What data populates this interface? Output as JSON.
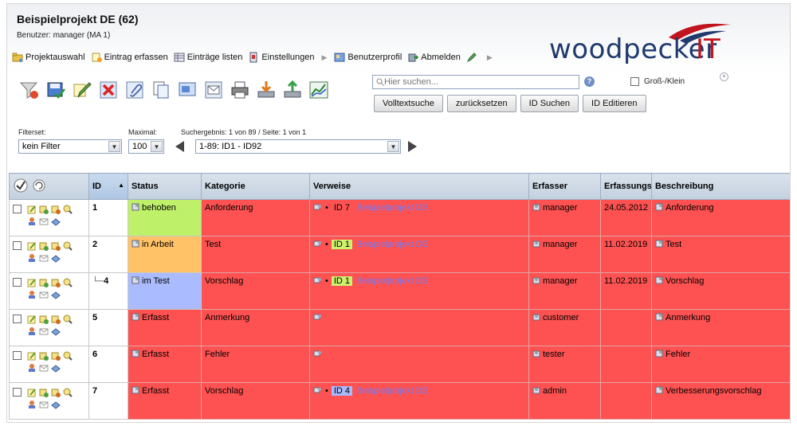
{
  "header": {
    "title": "Beispielprojekt DE (62)",
    "user": "Benutzer: manager (MA 1)"
  },
  "logo": {
    "main": "woodpecker",
    "suffix": "IT"
  },
  "menu": [
    {
      "label": "Projektauswahl",
      "icon": "folder-icon"
    },
    {
      "label": "Eintrag erfassen",
      "icon": "add-entry-icon"
    },
    {
      "label": "Einträge listen",
      "icon": "list-icon"
    },
    {
      "label": "Einstellungen",
      "icon": "settings-icon"
    },
    {
      "label": "Benutzerprofil",
      "icon": "profile-icon"
    },
    {
      "label": "Abmelden",
      "icon": "logout-icon"
    }
  ],
  "search": {
    "placeholder": "Hier suchen...",
    "case_label": "Groß-/Klein",
    "buttons": {
      "fulltext": "Volltextsuche",
      "reset": "zurücksetzen",
      "id_search": "ID Suchen",
      "id_edit": "ID Editieren"
    }
  },
  "filters": {
    "filterset_label": "Filterset:",
    "filterset_value": "kein Filter",
    "max_label": "Maximal:",
    "max_value": "100",
    "result_label": "Suchergebnis:  1 von 89 / Seite: 1 von 1",
    "result_value": "1-89: ID1 - ID92"
  },
  "table": {
    "headers": {
      "id": "ID",
      "status": "Status",
      "kategorie": "Kategorie",
      "verweise": "Verweise",
      "erfasser": "Erfasser",
      "datum": "Erfassungsdatum",
      "beschreibung": "Beschreibung"
    },
    "rows": [
      {
        "id": "1",
        "status": "behoben",
        "kategorie": "Anforderung",
        "ref_id": "ID 7",
        "ref_project": "Beispielprojekt DE",
        "erfasser": "manager",
        "datum": "24.05.2012",
        "beschreibung": "Anforderung"
      },
      {
        "id": "2",
        "status": "in Arbeit",
        "kategorie": "Test",
        "ref_id": "ID 1",
        "ref_project": "Beispielprojekt DE",
        "erfasser": "manager",
        "datum": "11.02.2019",
        "beschreibung": "Test"
      },
      {
        "id": "4",
        "status": "im Test",
        "kategorie": "Vorschlag",
        "ref_id": "ID 1",
        "ref_project": "Beispielprojekt DE",
        "erfasser": "manager",
        "datum": "11.02.2019",
        "beschreibung": "Vorschlag"
      },
      {
        "id": "5",
        "status": "Erfasst",
        "kategorie": "Anmerkung",
        "ref_id": "",
        "ref_project": "",
        "erfasser": "customer",
        "datum": "",
        "beschreibung": "Anmerkung"
      },
      {
        "id": "6",
        "status": "Erfasst",
        "kategorie": "Fehler",
        "ref_id": "",
        "ref_project": "",
        "erfasser": "tester",
        "datum": "",
        "beschreibung": "Fehler"
      },
      {
        "id": "7",
        "status": "Erfasst",
        "kategorie": "Vorschlag",
        "ref_id": "ID 4",
        "ref_project": "Beispielprojekt DE",
        "erfasser": "admin",
        "datum": "",
        "beschreibung": "Verbesserungsvorschlag"
      }
    ]
  },
  "colors": {
    "row_red": "#fe5151",
    "status_green": "#bff06a",
    "status_orange": "#ffc266",
    "status_blue": "#aabbff",
    "link": "#6a7cff"
  }
}
